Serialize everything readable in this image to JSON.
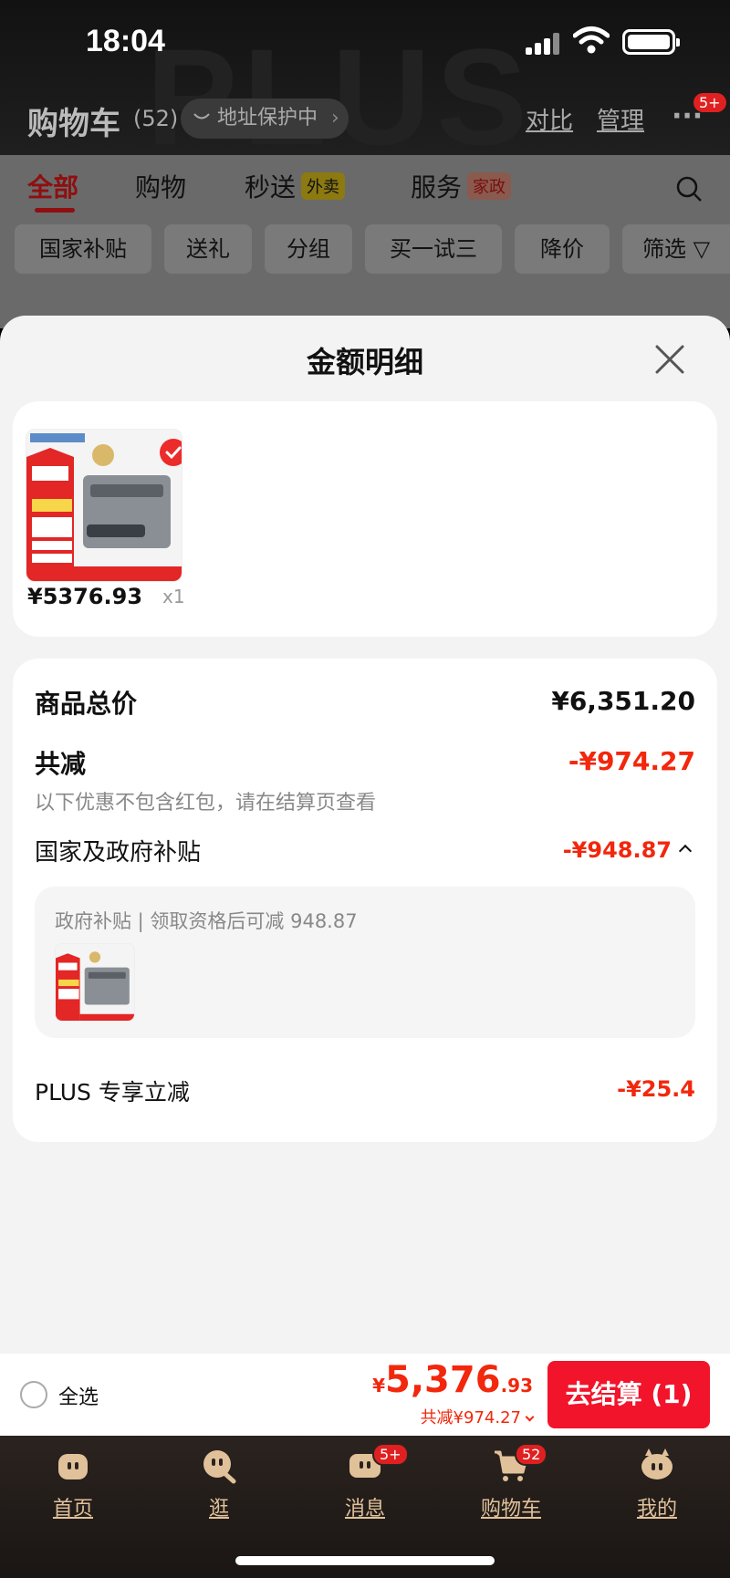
{
  "status_bar": {
    "time": "18:04"
  },
  "header": {
    "watermark": "PLUS",
    "title": "购物车",
    "count": "(52)",
    "address_pill": "地址保护中",
    "compare": "对比",
    "manage": "管理",
    "more_badge": "5+"
  },
  "background": {
    "tabs": [
      {
        "label": "全部",
        "active": true
      },
      {
        "label": "购物"
      },
      {
        "label": "秒送",
        "tag": "外卖"
      },
      {
        "label": "服务",
        "tag": "家政"
      }
    ],
    "chips": [
      "国家补贴",
      "送礼",
      "分组",
      "买一试三",
      "降价",
      "筛选"
    ]
  },
  "sheet": {
    "title": "金额明细",
    "item": {
      "price": "¥5376.93",
      "qty": "x1"
    },
    "summary": {
      "total_label": "商品总价",
      "total_value": "¥6,351.20",
      "discount_label": "共减",
      "discount_value": "-¥974.27",
      "discount_note": "以下优惠不包含红包，请在结算页查看",
      "gov_label": "国家及政府补贴",
      "gov_value": "-¥948.87",
      "subsidy_text": "政府补贴 | 领取资格后可减 948.87",
      "plus_label": "PLUS 专享立减",
      "plus_value": "-¥25.4"
    }
  },
  "checkout": {
    "select_all": "全选",
    "price_symbol": "¥",
    "price_int": "5,376",
    "price_dec": ".93",
    "saved": "共减¥974.27",
    "button": "去结算 (1)"
  },
  "bottom_nav": [
    {
      "label": "首页",
      "icon": "home-icon"
    },
    {
      "label": "逛",
      "icon": "browse-icon"
    },
    {
      "label": "消息",
      "icon": "message-icon",
      "badge": "5+"
    },
    {
      "label": "购物车",
      "icon": "cart-icon",
      "badge": "52"
    },
    {
      "label": "我的",
      "icon": "profile-icon"
    }
  ],
  "colors": {
    "accent": "#f2270c",
    "button": "#f2142b",
    "nav_text": "#e0c19a"
  }
}
